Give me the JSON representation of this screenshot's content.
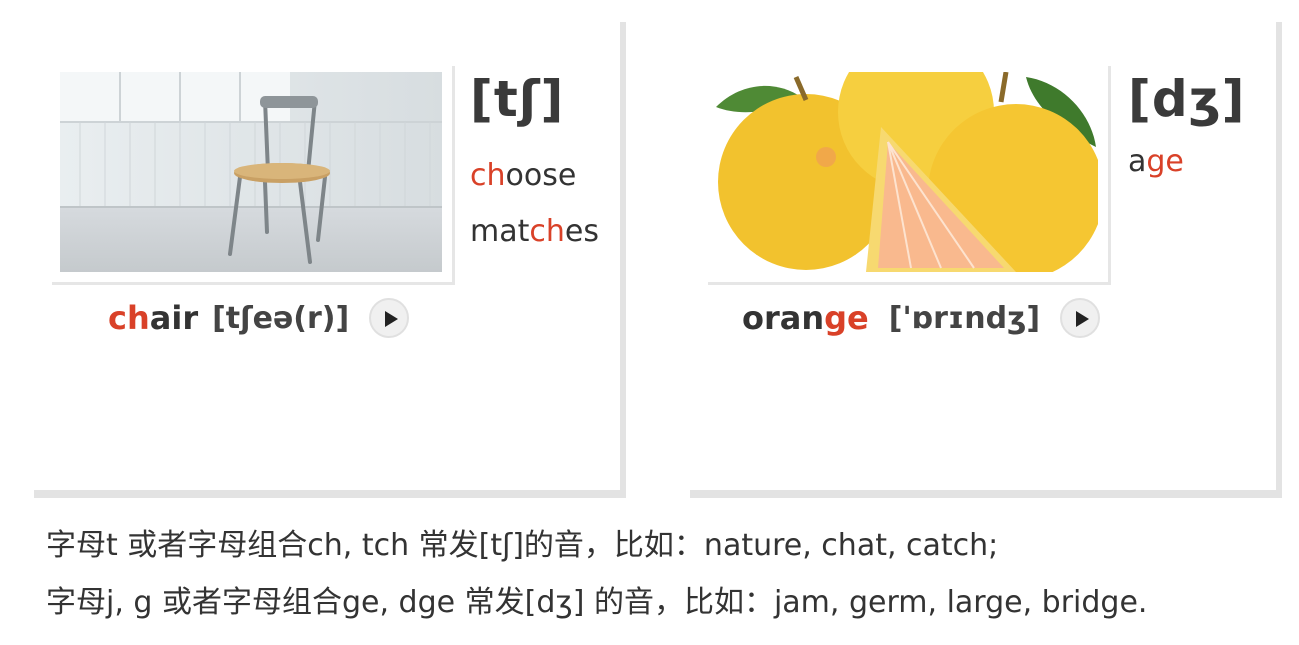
{
  "left_card": {
    "ipa_symbol": "[tʃ]",
    "examples": [
      {
        "highlight": "ch",
        "rest": "oose"
      },
      {
        "pre": "mat",
        "highlight": "ch",
        "post": "es"
      }
    ],
    "word": {
      "highlight": "ch",
      "rest": "air"
    },
    "phonetic": "[tʃeə(r)]",
    "image_icon": "chair-photo"
  },
  "right_card": {
    "ipa_symbol": "[dʒ]",
    "examples": [
      {
        "pre": "a",
        "highlight": "ge"
      }
    ],
    "word": {
      "pre": "oran",
      "highlight": "ge"
    },
    "phonetic": "['ɒrɪndʒ]",
    "image_icon": "grapefruit-photo"
  },
  "notes": [
    "字母t 或者字母组合ch, tch 常发[tʃ]的音，比如：nature, chat, catch;",
    "字母j, g 或者字母组合ge, dge 常发[dʒ] 的音，比如：jam, germ, large, bridge."
  ],
  "colors": {
    "highlight": "#d94128",
    "text": "#333333",
    "border": "#e3e3e3"
  },
  "icons": {
    "play": "play-icon"
  }
}
